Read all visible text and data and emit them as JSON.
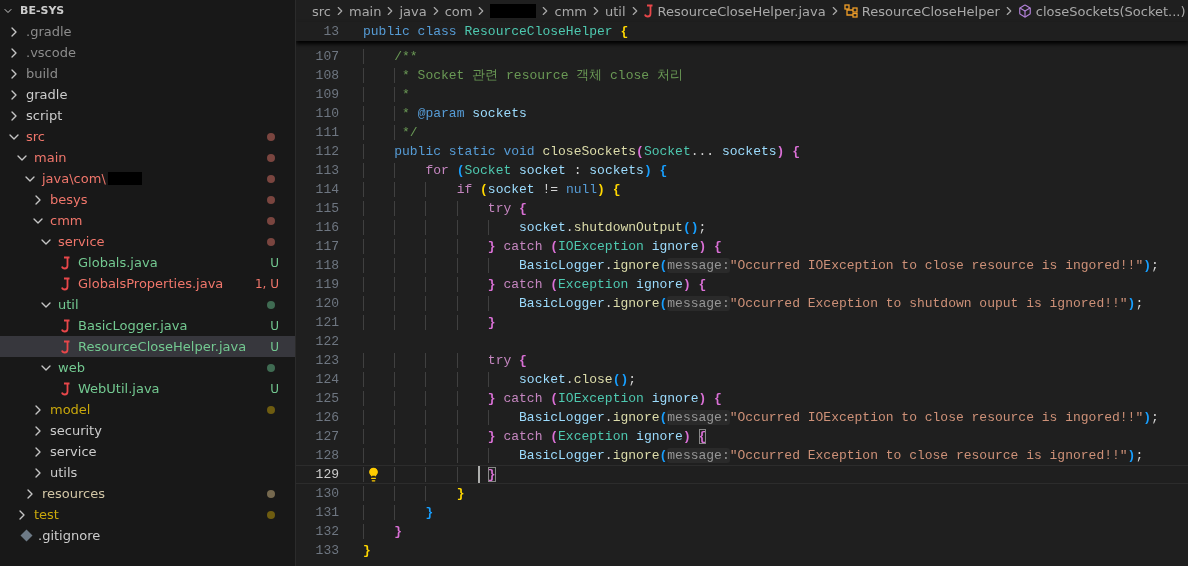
{
  "explorer": {
    "title": "BE-SYS",
    "expanded": true,
    "items": [
      {
        "label": ".gradle",
        "kind": "folder",
        "expanded": false,
        "selected": false,
        "color": "#8c8c8c"
      },
      {
        "label": ".vscode",
        "kind": "folder",
        "expanded": false,
        "selected": false,
        "color": "#8c8c8c"
      },
      {
        "label": "build",
        "kind": "folder",
        "expanded": false,
        "selected": false,
        "color": "#8c8c8c"
      },
      {
        "label": "gradle",
        "kind": "folder",
        "expanded": false,
        "selected": false,
        "color": "#cccccc"
      },
      {
        "label": "script",
        "kind": "folder",
        "expanded": false,
        "selected": false,
        "color": "#cccccc"
      },
      {
        "label": "src",
        "kind": "folder",
        "expanded": true,
        "selected": false,
        "color": "#f0766b",
        "dot": {
          "color": "#7a453f"
        },
        "children": [
          {
            "label": "main",
            "kind": "folder",
            "expanded": true,
            "selected": false,
            "color": "#f0766b",
            "dot": {
              "color": "#7a453f"
            },
            "children": [
              {
                "label": "java\\com\\",
                "kind": "folder",
                "expanded": true,
                "selected": false,
                "color": "#f0766b",
                "dot": {
                  "color": "#7a453f"
                },
                "redacted": true,
                "children": [
                  {
                    "label": "besys",
                    "kind": "folder",
                    "expanded": false,
                    "selected": false,
                    "color": "#f0766b",
                    "dot": {
                      "color": "#7a453f"
                    }
                  },
                  {
                    "label": "cmm",
                    "kind": "folder",
                    "expanded": true,
                    "selected": false,
                    "color": "#f0766b",
                    "dot": {
                      "color": "#7a453f"
                    },
                    "children": [
                      {
                        "label": "service",
                        "kind": "folder",
                        "expanded": true,
                        "selected": false,
                        "color": "#f0766b",
                        "dot": {
                          "color": "#7a453f"
                        },
                        "children": [
                          {
                            "label": "Globals.java",
                            "kind": "file",
                            "selected": false,
                            "color": "#73c991",
                            "badge": "U"
                          },
                          {
                            "label": "GlobalsProperties.java",
                            "kind": "file",
                            "selected": false,
                            "color": "#f0766b",
                            "badge": "1, U"
                          }
                        ]
                      },
                      {
                        "label": "util",
                        "kind": "folder",
                        "expanded": true,
                        "selected": false,
                        "color": "#73c991",
                        "dot": {
                          "color": "#3f6b52"
                        },
                        "children": [
                          {
                            "label": "BasicLogger.java",
                            "kind": "file",
                            "selected": false,
                            "color": "#73c991",
                            "badge": "U"
                          },
                          {
                            "label": "ResourceCloseHelper.java",
                            "kind": "file",
                            "selected": true,
                            "color": "#73c991",
                            "badge": "U"
                          }
                        ]
                      },
                      {
                        "label": "web",
                        "kind": "folder",
                        "expanded": true,
                        "selected": false,
                        "color": "#73c991",
                        "dot": {
                          "color": "#3f6b52"
                        },
                        "children": [
                          {
                            "label": "WebUtil.java",
                            "kind": "file",
                            "selected": false,
                            "color": "#73c991",
                            "badge": "U"
                          }
                        ]
                      }
                    ]
                  },
                  {
                    "label": "model",
                    "kind": "folder",
                    "expanded": false,
                    "selected": false,
                    "color": "#c9a80c",
                    "dot": {
                      "color": "#6e5c10"
                    }
                  },
                  {
                    "label": "security",
                    "kind": "folder",
                    "expanded": false,
                    "selected": false,
                    "color": "#cccccc"
                  },
                  {
                    "label": "service",
                    "kind": "folder",
                    "expanded": false,
                    "selected": false,
                    "color": "#cccccc"
                  },
                  {
                    "label": "utils",
                    "kind": "folder",
                    "expanded": false,
                    "selected": false,
                    "color": "#cccccc"
                  }
                ]
              },
              {
                "label": "resources",
                "kind": "folder",
                "expanded": false,
                "selected": false,
                "color": "#d2c6a6",
                "dot": {
                  "color": "#76694f"
                }
              }
            ]
          },
          {
            "label": "test",
            "kind": "folder",
            "expanded": false,
            "selected": false,
            "color": "#c9a80c",
            "dot": {
              "color": "#6e5c10"
            }
          }
        ]
      },
      {
        "label": ".gitignore",
        "kind": "gitignore",
        "selected": false,
        "color": "#cccccc"
      }
    ]
  },
  "breadcrumb": [
    {
      "kind": "folder",
      "label": "src"
    },
    {
      "kind": "folder",
      "label": "main"
    },
    {
      "kind": "folder",
      "label": "java"
    },
    {
      "kind": "folder",
      "label": "com"
    },
    {
      "kind": "redacted"
    },
    {
      "kind": "folder",
      "label": "cmm"
    },
    {
      "kind": "folder",
      "label": "util"
    },
    {
      "kind": "file",
      "label": "ResourceCloseHelper.java"
    },
    {
      "kind": "class",
      "label": "ResourceCloseHelper"
    },
    {
      "kind": "method",
      "label": "closeSockets(Socket...)"
    }
  ],
  "sticky": {
    "number": "13",
    "tokens": [
      {
        "kind": "keyword",
        "text": "public class "
      },
      {
        "kind": "typename",
        "text": "ResourceCloseHelper "
      },
      {
        "kind": "bracket",
        "color": "#ffd700",
        "text": "{"
      }
    ]
  },
  "lines": [
    {
      "number": "107",
      "current": false,
      "tokens": [
        {
          "kind": "comment",
          "text": "    /**"
        }
      ]
    },
    {
      "number": "108",
      "current": false,
      "tokens": [
        {
          "kind": "comment",
          "text": "     * Socket 관련 resource 객체 close 처리"
        }
      ]
    },
    {
      "number": "109",
      "current": false,
      "tokens": [
        {
          "kind": "comment",
          "text": "     *"
        }
      ]
    },
    {
      "number": "110",
      "current": false,
      "tokens": [
        {
          "kind": "comment",
          "text": "     * "
        },
        {
          "kind": "doctag",
          "text": "@param"
        },
        {
          "kind": "variable",
          "text": " sockets"
        }
      ]
    },
    {
      "number": "111",
      "current": false,
      "tokens": [
        {
          "kind": "comment",
          "text": "     */"
        }
      ]
    },
    {
      "number": "112",
      "current": false,
      "tokens": [
        {
          "kind": "keyword",
          "text": "    public static void "
        },
        {
          "kind": "function",
          "text": "closeSockets"
        },
        {
          "kind": "bracket",
          "color": "#da70d6",
          "text": "("
        },
        {
          "kind": "typename",
          "text": "Socket"
        },
        {
          "kind": "plain",
          "text": "... "
        },
        {
          "kind": "variable",
          "text": "sockets"
        },
        {
          "kind": "bracket",
          "color": "#da70d6",
          "text": ") "
        },
        {
          "kind": "bracket",
          "color": "#da70d6",
          "text": "{"
        }
      ]
    },
    {
      "number": "113",
      "current": false,
      "tokens": [
        {
          "kind": "control",
          "text": "        for "
        },
        {
          "kind": "bracket",
          "color": "#179fff",
          "text": "("
        },
        {
          "kind": "typename",
          "text": "Socket "
        },
        {
          "kind": "variable",
          "text": "socket"
        },
        {
          "kind": "plain",
          "text": " : "
        },
        {
          "kind": "variable",
          "text": "sockets"
        },
        {
          "kind": "bracket",
          "color": "#179fff",
          "text": ") "
        },
        {
          "kind": "bracket",
          "color": "#179fff",
          "text": "{"
        }
      ]
    },
    {
      "number": "114",
      "current": false,
      "tokens": [
        {
          "kind": "control",
          "text": "            if "
        },
        {
          "kind": "bracket",
          "color": "#ffd700",
          "text": "("
        },
        {
          "kind": "variable",
          "text": "socket"
        },
        {
          "kind": "plain",
          "text": " != "
        },
        {
          "kind": "keyword",
          "text": "null"
        },
        {
          "kind": "bracket",
          "color": "#ffd700",
          "text": ") "
        },
        {
          "kind": "bracket",
          "color": "#ffd700",
          "text": "{"
        }
      ]
    },
    {
      "number": "115",
      "current": false,
      "tokens": [
        {
          "kind": "control",
          "text": "                try "
        },
        {
          "kind": "bracket",
          "color": "#da70d6",
          "text": "{"
        }
      ]
    },
    {
      "number": "116",
      "current": false,
      "tokens": [
        {
          "kind": "variable",
          "text": "                    socket"
        },
        {
          "kind": "plain",
          "text": "."
        },
        {
          "kind": "function",
          "text": "shutdownOutput"
        },
        {
          "kind": "bracket",
          "color": "#179fff",
          "text": "()"
        },
        {
          "kind": "plain",
          "text": ";"
        }
      ]
    },
    {
      "number": "117",
      "current": false,
      "tokens": [
        {
          "kind": "bracket",
          "color": "#da70d6",
          "text": "                }"
        },
        {
          "kind": "control",
          "text": " catch "
        },
        {
          "kind": "bracket",
          "color": "#da70d6",
          "text": "("
        },
        {
          "kind": "typename",
          "text": "IOException "
        },
        {
          "kind": "variable",
          "text": "ignore"
        },
        {
          "kind": "bracket",
          "color": "#da70d6",
          "text": ") "
        },
        {
          "kind": "bracket",
          "color": "#da70d6",
          "text": "{"
        }
      ]
    },
    {
      "number": "118",
      "current": false,
      "tokens": [
        {
          "kind": "variable",
          "text": "                    BasicLogger"
        },
        {
          "kind": "plain",
          "text": "."
        },
        {
          "kind": "function",
          "text": "ignore"
        },
        {
          "kind": "bracket",
          "color": "#179fff",
          "text": "("
        },
        {
          "kind": "hint",
          "text": "message:"
        },
        {
          "kind": "string",
          "text": "\"Occurred IOException to close resource is ingored!!\""
        },
        {
          "kind": "bracket",
          "color": "#179fff",
          "text": ")"
        },
        {
          "kind": "plain",
          "text": ";"
        }
      ]
    },
    {
      "number": "119",
      "current": false,
      "tokens": [
        {
          "kind": "bracket",
          "color": "#da70d6",
          "text": "                }"
        },
        {
          "kind": "control",
          "text": " catch "
        },
        {
          "kind": "bracket",
          "color": "#da70d6",
          "text": "("
        },
        {
          "kind": "typename",
          "text": "Exception "
        },
        {
          "kind": "variable",
          "text": "ignore"
        },
        {
          "kind": "bracket",
          "color": "#da70d6",
          "text": ") "
        },
        {
          "kind": "bracket",
          "color": "#da70d6",
          "text": "{"
        }
      ]
    },
    {
      "number": "120",
      "current": false,
      "tokens": [
        {
          "kind": "variable",
          "text": "                    BasicLogger"
        },
        {
          "kind": "plain",
          "text": "."
        },
        {
          "kind": "function",
          "text": "ignore"
        },
        {
          "kind": "bracket",
          "color": "#179fff",
          "text": "("
        },
        {
          "kind": "hint",
          "text": "message:"
        },
        {
          "kind": "string",
          "text": "\"Occurred Exception to shutdown ouput is ignored!!\""
        },
        {
          "kind": "bracket",
          "color": "#179fff",
          "text": ")"
        },
        {
          "kind": "plain",
          "text": ";"
        }
      ]
    },
    {
      "number": "121",
      "current": false,
      "tokens": [
        {
          "kind": "bracket",
          "color": "#da70d6",
          "text": "                }"
        }
      ]
    },
    {
      "number": "122",
      "current": false
    },
    {
      "number": "123",
      "current": false,
      "tokens": [
        {
          "kind": "control",
          "text": "                try "
        },
        {
          "kind": "bracket",
          "color": "#da70d6",
          "text": "{"
        }
      ]
    },
    {
      "number": "124",
      "current": false,
      "tokens": [
        {
          "kind": "variable",
          "text": "                    socket"
        },
        {
          "kind": "plain",
          "text": "."
        },
        {
          "kind": "function",
          "text": "close"
        },
        {
          "kind": "bracket",
          "color": "#179fff",
          "text": "()"
        },
        {
          "kind": "plain",
          "text": ";"
        }
      ]
    },
    {
      "number": "125",
      "current": false,
      "tokens": [
        {
          "kind": "bracket",
          "color": "#da70d6",
          "text": "                }"
        },
        {
          "kind": "control",
          "text": " catch "
        },
        {
          "kind": "bracket",
          "color": "#da70d6",
          "text": "("
        },
        {
          "kind": "typename",
          "text": "IOException "
        },
        {
          "kind": "variable",
          "text": "ignore"
        },
        {
          "kind": "bracket",
          "color": "#da70d6",
          "text": ") "
        },
        {
          "kind": "bracket",
          "color": "#da70d6",
          "text": "{"
        }
      ]
    },
    {
      "number": "126",
      "current": false,
      "tokens": [
        {
          "kind": "variable",
          "text": "                    BasicLogger"
        },
        {
          "kind": "plain",
          "text": "."
        },
        {
          "kind": "function",
          "text": "ignore"
        },
        {
          "kind": "bracket",
          "color": "#179fff",
          "text": "("
        },
        {
          "kind": "hint",
          "text": "message:"
        },
        {
          "kind": "string",
          "text": "\"Occurred IOException to close resource is ingored!!\""
        },
        {
          "kind": "bracket",
          "color": "#179fff",
          "text": ")"
        },
        {
          "kind": "plain",
          "text": ";"
        }
      ]
    },
    {
      "number": "127",
      "current": false,
      "tokens": [
        {
          "kind": "bracket",
          "color": "#da70d6",
          "text": "                }"
        },
        {
          "kind": "control",
          "text": " catch "
        },
        {
          "kind": "bracket",
          "color": "#da70d6",
          "text": "("
        },
        {
          "kind": "typename",
          "text": "Exception "
        },
        {
          "kind": "variable",
          "text": "ignore"
        },
        {
          "kind": "bracket",
          "color": "#da70d6",
          "text": ") "
        },
        {
          "kind": "bracket",
          "color": "#da70d6",
          "text": "{",
          "match": true
        }
      ]
    },
    {
      "number": "128",
      "current": false,
      "tokens": [
        {
          "kind": "variable",
          "text": "                    BasicLogger"
        },
        {
          "kind": "plain",
          "text": "."
        },
        {
          "kind": "function",
          "text": "ignore"
        },
        {
          "kind": "bracket",
          "color": "#179fff",
          "text": "("
        },
        {
          "kind": "hint",
          "text": "message:"
        },
        {
          "kind": "string",
          "text": "\"Occurred Exception to close resource is ignored!!\""
        },
        {
          "kind": "bracket",
          "color": "#179fff",
          "text": ")"
        },
        {
          "kind": "plain",
          "text": ";"
        }
      ]
    },
    {
      "number": "129",
      "current": true,
      "tokens": [
        {
          "kind": "bracket",
          "color": "#da70d6",
          "text": "                }",
          "match": true
        }
      ]
    },
    {
      "number": "130",
      "current": false,
      "tokens": [
        {
          "kind": "bracket",
          "color": "#ffd700",
          "text": "            }"
        }
      ]
    },
    {
      "number": "131",
      "current": false,
      "tokens": [
        {
          "kind": "bracket",
          "color": "#179fff",
          "text": "        }"
        }
      ]
    },
    {
      "number": "132",
      "current": false,
      "tokens": [
        {
          "kind": "bracket",
          "color": "#da70d6",
          "text": "    }"
        }
      ]
    },
    {
      "number": "133",
      "current": false,
      "tokens": [
        {
          "kind": "bracket",
          "color": "#ffd700",
          "text": "}"
        }
      ]
    }
  ]
}
